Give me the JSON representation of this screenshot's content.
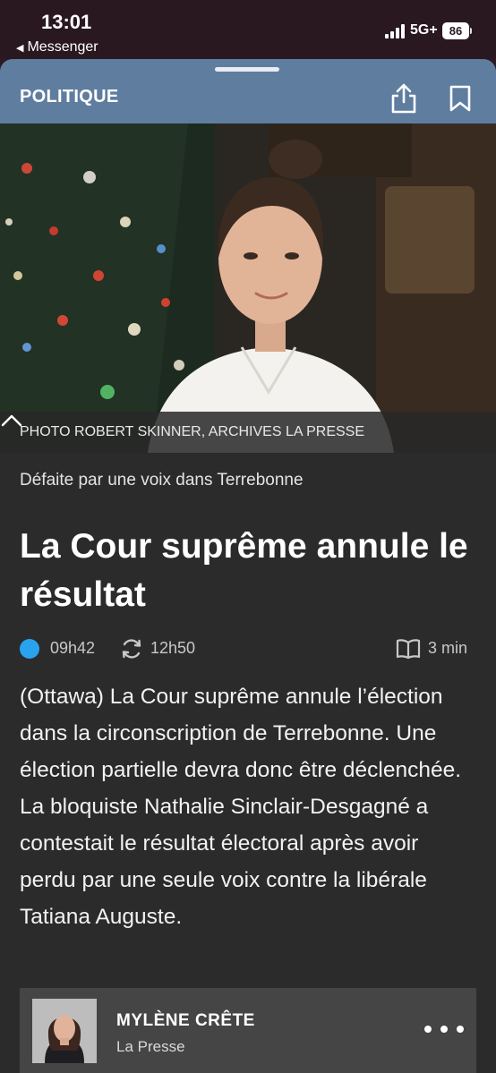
{
  "status_bar": {
    "time": "13:01",
    "back_app": "Messenger",
    "network": "5G+",
    "battery": "86"
  },
  "header": {
    "section": "POLITIQUE",
    "share_icon": "share-icon",
    "bookmark_icon": "bookmark-icon"
  },
  "photo": {
    "caption": "PHOTO ROBERT SKINNER, ARCHIVES LA PRESSE",
    "toggle_icon": "chevron-up-icon"
  },
  "article": {
    "kicker": "Défaite par une voix dans Terrebonne",
    "headline": "La Cour suprême annule le résultat",
    "published": "09h42",
    "updated": "12h50",
    "read_time": "3 min",
    "lede": "(Ottawa) La Cour suprême annule l’élection dans la circonscription de Terrebonne. Une élection partielle devra donc être déclenchée. La bloquiste Nathalie Sinclair-Desgagné a contestait le résultat électoral après avoir perdu par une seule voix contre la libérale Tatiana Auguste."
  },
  "author": {
    "name": "MYLÈNE CRÊTE",
    "organization": "La Presse"
  },
  "colors": {
    "header_bg": "#5f7d9f",
    "page_bg": "#2b2b2b",
    "live_dot": "#2aa3ef"
  }
}
